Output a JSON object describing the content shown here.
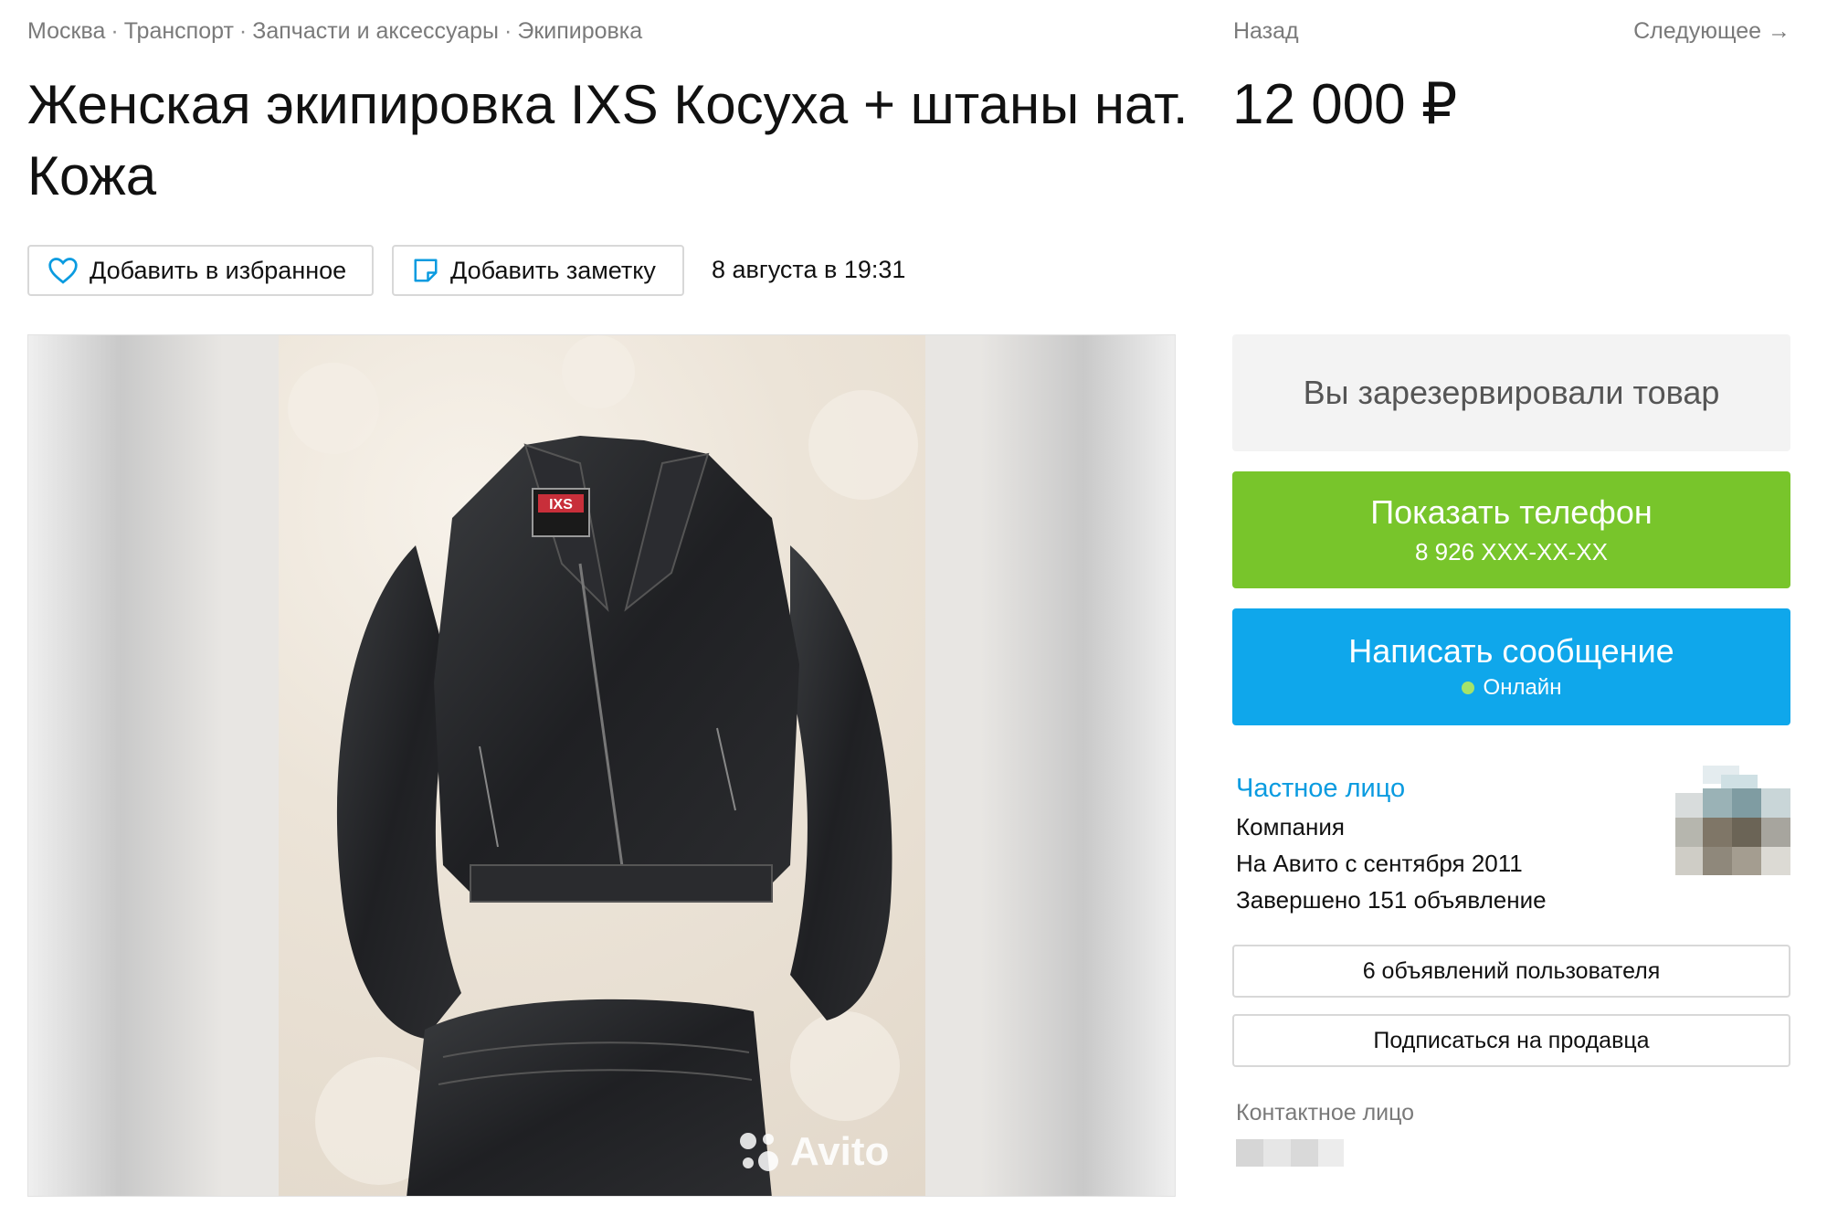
{
  "breadcrumbs": [
    "Москва",
    "Транспорт",
    "Запчасти и аксессуары",
    "Экипировка"
  ],
  "breadcrumb_separator": "·",
  "nav": {
    "back": "Назад",
    "next": "Следующее →"
  },
  "listing": {
    "title": "Женская экипировка IXS Косуха + штаны нат. Кожа",
    "price": "12 000 ₽",
    "date": "8 августа в 19:31"
  },
  "actions": {
    "favorite": "Добавить в избранное",
    "note": "Добавить заметку"
  },
  "gallery": {
    "watermark": "Avito",
    "jacket_label": "IXS"
  },
  "sidebar": {
    "reserved": "Вы зарезервировали товар",
    "phone_button": "Показать телефон",
    "phone_number": "8 926 XXX-XX-XX",
    "message_button": "Написать сообщение",
    "online_status": "Онлайн",
    "seller": {
      "name": "Частное лицо",
      "type": "Компания",
      "since": "На Авито с сентября 2011",
      "completed": "Завершено 151 объявление"
    },
    "user_ads_button": "6 объявлений пользователя",
    "subscribe_button": "Подписаться на продавца",
    "contact_label": "Контактное лицо"
  },
  "colors": {
    "green": "#78c52b",
    "blue": "#0fa7eb",
    "link": "#0a9be0",
    "reserved_bg": "#f3f3f3"
  }
}
